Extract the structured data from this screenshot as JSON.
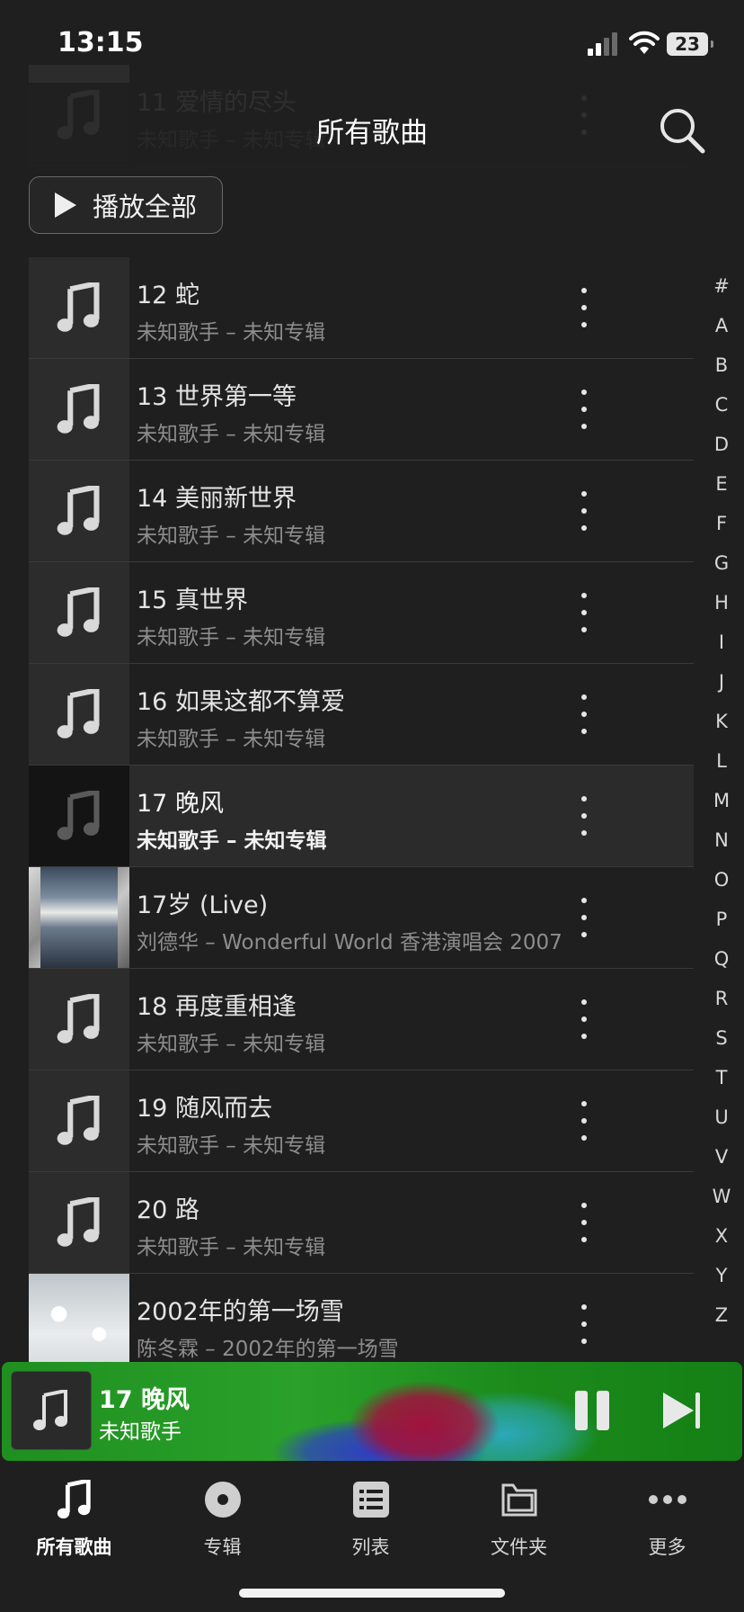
{
  "status": {
    "time": "13:15",
    "battery": "23"
  },
  "header": {
    "title": "所有歌曲",
    "play_all": "播放全部"
  },
  "list": {
    "partial_row": {
      "title": "11 爱情的尽头",
      "sub": "未知歌手 – 未知专辑"
    },
    "rows": [
      {
        "title": "12 蛇",
        "sub": "未知歌手 – 未知专辑",
        "thumb": "note"
      },
      {
        "title": "13 世界第一等",
        "sub": "未知歌手 – 未知专辑",
        "thumb": "note"
      },
      {
        "title": "14 美丽新世界",
        "sub": "未知歌手 – 未知专辑",
        "thumb": "note"
      },
      {
        "title": "15 真世界",
        "sub": "未知歌手 – 未知专辑",
        "thumb": "note"
      },
      {
        "title": "16 如果这都不算爱",
        "sub": "未知歌手 – 未知专辑",
        "thumb": "note"
      },
      {
        "title": "17 晚风",
        "sub": "未知歌手 – 未知专辑",
        "thumb": "note-dark",
        "playing": true
      },
      {
        "title": "17岁 (Live)",
        "sub": "刘德华 – Wonderful World 香港演唱会 2007",
        "thumb": "album-art"
      },
      {
        "title": "18 再度重相逢",
        "sub": "未知歌手 – 未知专辑",
        "thumb": "note"
      },
      {
        "title": "19 随风而去",
        "sub": "未知歌手 – 未知专辑",
        "thumb": "note"
      },
      {
        "title": "20 路",
        "sub": "未知歌手 – 未知专辑",
        "thumb": "note"
      },
      {
        "title": "2002年的第一场雪",
        "sub": "陈冬霖 – 2002年的第一场雪",
        "thumb": "album-art-snow"
      }
    ]
  },
  "index_letters": [
    "#",
    "A",
    "B",
    "C",
    "D",
    "E",
    "F",
    "G",
    "H",
    "I",
    "J",
    "K",
    "L",
    "M",
    "N",
    "O",
    "P",
    "Q",
    "R",
    "S",
    "T",
    "U",
    "V",
    "W",
    "X",
    "Y",
    "Z"
  ],
  "mini_player": {
    "title": "17 晚风",
    "artist": "未知歌手"
  },
  "tabs": [
    {
      "label": "所有歌曲",
      "icon": "music-note-icon",
      "active": true
    },
    {
      "label": "专辑",
      "icon": "disc-icon",
      "active": false
    },
    {
      "label": "列表",
      "icon": "list-icon",
      "active": false
    },
    {
      "label": "文件夹",
      "icon": "folder-icon",
      "active": false
    },
    {
      "label": "更多",
      "icon": "more-horizontal-icon",
      "active": false
    }
  ],
  "colors": {
    "background": "#1f1f1f",
    "mini_player_green": "#2aa12a",
    "divider": "#3a3a3a"
  }
}
